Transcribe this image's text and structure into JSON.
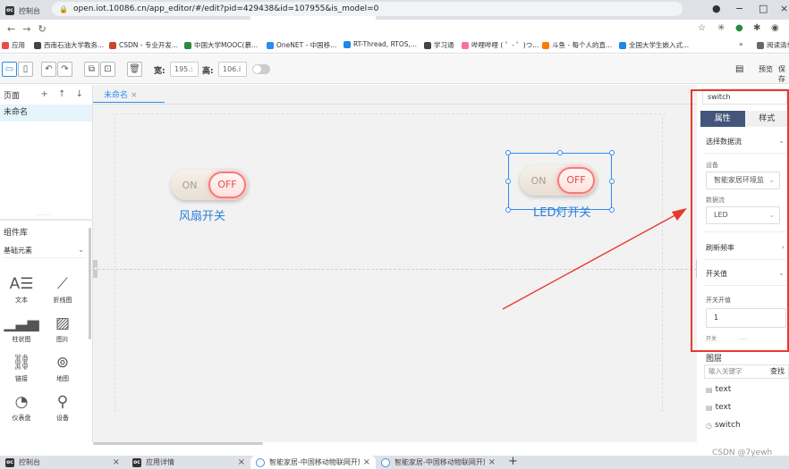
{
  "browser": {
    "tabs": [
      {
        "title": "控制台",
        "favicon": "oc-icon"
      },
      {
        "title": "应用详情",
        "favicon": "oc-icon"
      },
      {
        "title": "智能家居-中国移动物联网开放平",
        "favicon": "cloud-icon"
      },
      {
        "title": "智能家居-中国移动物联网开放平",
        "favicon": "cloud-icon"
      }
    ],
    "new_tab": "+",
    "url": "open.iot.10086.cn/app_editor/#/edit?pid=429438&id=107955&is_model=0",
    "bookmarks": [
      {
        "label": "应用",
        "color": "#e84b4b"
      },
      {
        "label": "西南石油大学教务...",
        "color": "#444444"
      },
      {
        "label": "CSDN - 专业开发...",
        "color": "#c8472b"
      },
      {
        "label": "中国大学MOOC(慕...",
        "color": "#2b8a3e"
      },
      {
        "label": "OneNET - 中国移...",
        "color": "#2d8cf0"
      },
      {
        "label": "RT-Thread, RTOS,...",
        "color": "#1e88e5"
      },
      {
        "label": "学习通",
        "color": "#444444"
      },
      {
        "label": "哔哩哔哩 ( ゜- ゜)つ...",
        "color": "#fb7299"
      },
      {
        "label": "斗鱼 - 每个人的直...",
        "color": "#ff7a00"
      },
      {
        "label": "全国大学生嵌入式...",
        "color": "#1e88e5"
      },
      {
        "label": "»",
        "color": "#ffffff"
      },
      {
        "label": "阅读清单",
        "color": "#666666"
      }
    ]
  },
  "toolbar": {
    "width_label": "宽:",
    "width_value": "195.:",
    "height_label": "高:",
    "height_value": "106.i",
    "preview_label": "预览",
    "save_label": "保存"
  },
  "left": {
    "pages_title": "页面",
    "page_actions": "+ ↑ ↓",
    "pages": [
      "未命名"
    ],
    "drag_dots": "......",
    "library_title": "组件库",
    "library_select": "基础元素",
    "components": [
      {
        "label": "文本",
        "icon": "text-icon"
      },
      {
        "label": "折线图",
        "icon": "line-chart-icon"
      },
      {
        "label": "柱状图",
        "icon": "bar-chart-icon"
      },
      {
        "label": "图片",
        "icon": "image-icon"
      },
      {
        "label": "链接",
        "icon": "link-icon"
      },
      {
        "label": "地图",
        "icon": "map-pin-icon"
      },
      {
        "label": "仪表盘",
        "icon": "gauge-icon"
      },
      {
        "label": "设备",
        "icon": "device-icon"
      }
    ]
  },
  "canvas": {
    "tab_label": "未命名",
    "tab_close": "×",
    "widgets": [
      {
        "on": "ON",
        "off": "OFF",
        "label": "风扇开关"
      },
      {
        "on": "ON",
        "off": "OFF",
        "label": "LED灯开关"
      }
    ]
  },
  "right": {
    "search_value": "switch",
    "tab_props": "属性",
    "tab_style": "样式",
    "select_stream": "选择数据流",
    "device_label": "设备",
    "device_value": "智能家居环境监",
    "stream_label": "数据流",
    "stream_value": "LED",
    "refresh_rate": "刷新频率",
    "switch_value": "开关值",
    "switch_on_label": "开关开值",
    "switch_on_value": "1",
    "more_dots": "......",
    "cut_label": "开关",
    "layers_title": "图层",
    "layer_search_placeholder": "输入关键字",
    "layer_search_button": "查找",
    "layers": [
      "text",
      "text",
      "switch"
    ]
  },
  "watermark": "CSDN @7yewh",
  "colors": {
    "accent": "#2d8cf0",
    "tab_active": "#43557a",
    "highlight_red": "#e8392d",
    "switch_off": "#e84b4b"
  }
}
